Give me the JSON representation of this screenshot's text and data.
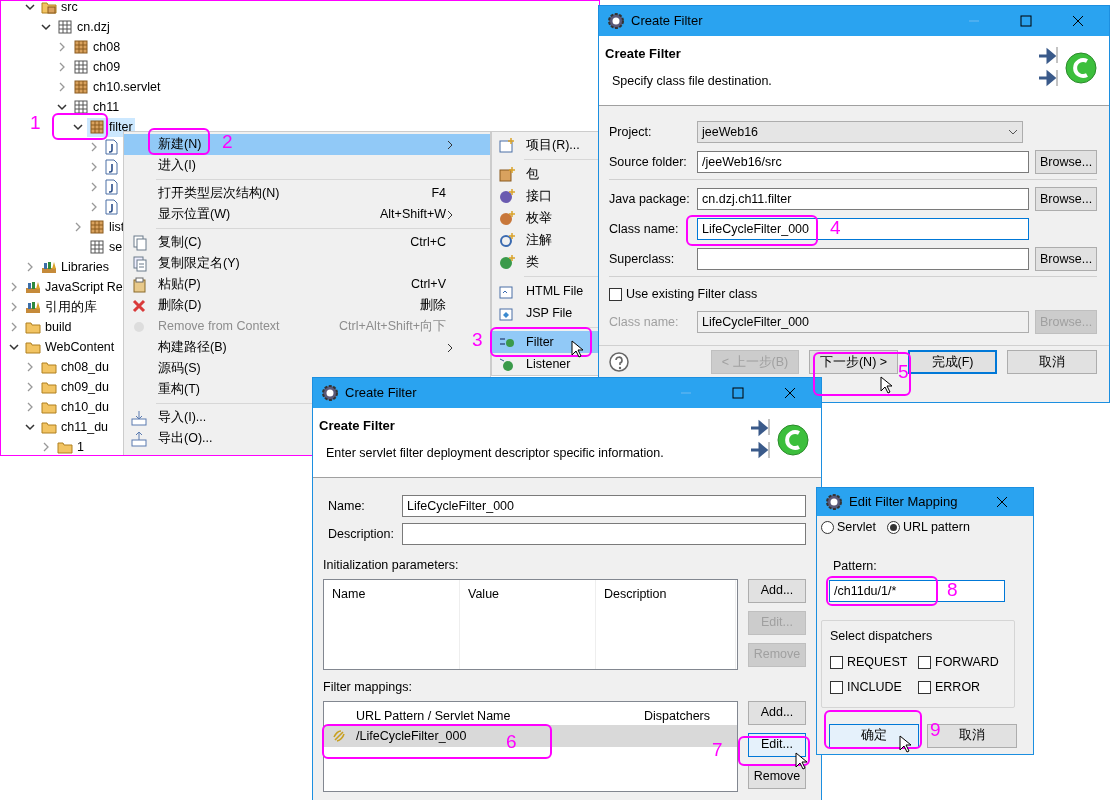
{
  "tree": {
    "project_children": [
      {
        "label": "src",
        "kind": "source-folder",
        "expanded": true,
        "selected": false,
        "children": [
          {
            "label": "cn.dzj",
            "kind": "empty-package",
            "expanded": true,
            "selected": false,
            "children": [
              {
                "label": "ch08",
                "kind": "package",
                "expanded": false,
                "selected": false
              },
              {
                "label": "ch09",
                "kind": "empty-package",
                "expanded": false,
                "selected": false
              },
              {
                "label": "ch10.servlet",
                "kind": "package",
                "expanded": false,
                "selected": false
              },
              {
                "label": "ch11",
                "kind": "empty-package",
                "expanded": true,
                "selected": false,
                "children": [
                  {
                    "label": "filter",
                    "kind": "package",
                    "expanded": true,
                    "selected": true,
                    "children": [
                      {
                        "kind": "java-file",
                        "expanded": false,
                        "selected": false
                      },
                      {
                        "kind": "java-file",
                        "expanded": false,
                        "selected": false
                      },
                      {
                        "kind": "java-file",
                        "expanded": false,
                        "selected": false
                      },
                      {
                        "kind": "java-file",
                        "expanded": false,
                        "selected": false
                      }
                    ]
                  },
                  {
                    "label": "list",
                    "kind": "package",
                    "expanded": false,
                    "selected": false
                  },
                  {
                    "label": "se",
                    "kind": "empty-package",
                    "selected": false
                  }
                ]
              }
            ]
          }
        ]
      },
      {
        "label": "Libraries",
        "kind": "library",
        "expanded": false,
        "selected": false
      }
    ],
    "items": [
      {
        "label": "JavaScript Re",
        "kind": "library",
        "expanded": false,
        "selected": false
      },
      {
        "label": "引用的库",
        "kind": "library",
        "expanded": false,
        "selected": false
      },
      {
        "label": "build",
        "kind": "folder",
        "expanded": false,
        "selected": false
      },
      {
        "label": "WebContent",
        "kind": "folder",
        "expanded": true,
        "selected": false,
        "children": [
          {
            "label": "ch08_du",
            "kind": "folder",
            "expanded": false,
            "selected": false
          },
          {
            "label": "ch09_du",
            "kind": "folder",
            "expanded": false,
            "selected": false
          },
          {
            "label": "ch10_du",
            "kind": "folder",
            "expanded": false,
            "selected": false
          },
          {
            "label": "ch11_du",
            "kind": "folder",
            "expanded": true,
            "selected": false,
            "children": [
              {
                "label": "1",
                "kind": "folder",
                "expanded": false,
                "selected": false
              }
            ]
          }
        ]
      }
    ]
  },
  "context_menu": [
    {
      "kind": "item",
      "label": "新建(N)",
      "submenu": true,
      "selected": true,
      "disabled": false
    },
    {
      "kind": "item",
      "label": "进入(I)",
      "submenu": false,
      "selected": false,
      "disabled": false
    },
    {
      "kind": "separator"
    },
    {
      "kind": "item",
      "label": "打开类型层次结构(N)",
      "shortcut": "F4",
      "submenu": false,
      "selected": false,
      "disabled": false
    },
    {
      "kind": "item",
      "label": "显示位置(W)",
      "shortcut": "Alt+Shift+W",
      "submenu": true,
      "selected": false,
      "disabled": false
    },
    {
      "kind": "separator"
    },
    {
      "kind": "item",
      "label": "复制(C)",
      "shortcut": "Ctrl+C",
      "submenu": false,
      "selected": false,
      "disabled": false
    },
    {
      "kind": "item",
      "label": "复制限定名(Y)",
      "submenu": false,
      "selected": false,
      "disabled": false
    },
    {
      "kind": "item",
      "label": "粘贴(P)",
      "shortcut": "Ctrl+V",
      "submenu": false,
      "selected": false,
      "disabled": false
    },
    {
      "kind": "item",
      "label": "删除(D)",
      "shortcut": "删除",
      "submenu": false,
      "selected": false,
      "disabled": false
    },
    {
      "kind": "item",
      "label": "Remove from Context",
      "shortcut": "Ctrl+Alt+Shift+向下",
      "submenu": false,
      "selected": false,
      "disabled": true
    },
    {
      "kind": "item",
      "label": "构建路径(B)",
      "submenu": true,
      "selected": false,
      "disabled": false
    },
    {
      "kind": "item",
      "label": "源码(S)",
      "submenu": false,
      "selected": false,
      "disabled": false
    },
    {
      "kind": "item",
      "label": "重构(T)",
      "selected": false,
      "disabled": false
    },
    {
      "kind": "separator"
    },
    {
      "kind": "item",
      "label": "导入(I)...",
      "selected": false,
      "disabled": false
    },
    {
      "kind": "item",
      "label": "导出(O)...",
      "selected": false,
      "disabled": false
    }
  ],
  "submenu": [
    {
      "kind": "item",
      "label": "项目(R)...",
      "selected": false
    },
    {
      "kind": "separator"
    },
    {
      "kind": "item",
      "label": "包",
      "selected": false
    },
    {
      "kind": "item",
      "label": "接口",
      "selected": false
    },
    {
      "kind": "item",
      "label": "枚举",
      "selected": false
    },
    {
      "kind": "item",
      "label": "注解",
      "selected": false
    },
    {
      "kind": "item",
      "label": "类",
      "selected": false
    },
    {
      "kind": "separator"
    },
    {
      "kind": "item",
      "label": "HTML File",
      "selected": false
    },
    {
      "kind": "item",
      "label": "JSP File",
      "selected": false
    },
    {
      "kind": "separator"
    },
    {
      "kind": "item",
      "label": "Filter",
      "selected": true
    },
    {
      "kind": "item",
      "label": "Listener",
      "selected": false
    }
  ],
  "class_dialog": {
    "title": "Create Filter",
    "heading": "Create Filter",
    "description": "Specify class file destination.",
    "project": {
      "label": "Project:",
      "value": "jeeWeb16"
    },
    "fields": [
      {
        "kind": "field",
        "label": "Source folder:",
        "value": "/jeeWeb16/src",
        "browse": "Browse...",
        "focused": false
      },
      {
        "kind": "separator"
      },
      {
        "kind": "field",
        "label": "Java package:",
        "value": "cn.dzj.ch11.filter",
        "browse": "Browse...",
        "focused": false
      },
      {
        "kind": "field",
        "label": "Class name:",
        "value": "LifeCycleFilter_000",
        "focused": true
      },
      {
        "kind": "field",
        "label": "Superclass:",
        "browse": "Browse...",
        "focused": false
      },
      {
        "kind": "separator"
      }
    ],
    "use_existing": {
      "label": "Use existing Filter class",
      "checked": false
    },
    "existing_class": {
      "label": "Class name:",
      "value": "LifeCycleFilter_000",
      "browse": "Browse...",
      "disabled": true
    },
    "buttons": [
      {
        "label": "< 上一步(B)",
        "disabled": true,
        "default": false
      },
      {
        "label": "下一步(N) >",
        "disabled": false,
        "default": false
      },
      {
        "label": "完成(F)",
        "disabled": false,
        "default": true
      },
      {
        "label": "取消",
        "disabled": false,
        "default": false
      }
    ]
  },
  "filter_dialog": {
    "title": "Create Filter",
    "heading": "Create Filter",
    "description": "Enter servlet filter deployment descriptor specific information.",
    "fields": [
      {
        "label": "Name:",
        "value": "LifeCycleFilter_000"
      },
      {
        "label": "Description:"
      }
    ],
    "init_params": {
      "label": "Initialization parameters:",
      "columns": [
        "Name",
        "Value",
        "Description"
      ],
      "buttons": [
        {
          "label": "Add...",
          "disabled": false,
          "focused": false
        },
        {
          "label": "Edit...",
          "disabled": true,
          "focused": false
        },
        {
          "label": "Remove",
          "disabled": true,
          "focused": false
        }
      ]
    },
    "mappings": {
      "label": "Filter mappings:",
      "columns": [
        "URL Pattern / Servlet Name",
        "Dispatchers"
      ],
      "rows": [
        {
          "pattern": "/LifeCycleFilter_000",
          "selected": true
        }
      ],
      "buttons": [
        {
          "label": "Add...",
          "disabled": false,
          "focused": false
        },
        {
          "label": "Edit...",
          "disabled": false,
          "focused": true
        },
        {
          "label": "Remove",
          "disabled": false,
          "focused": false
        }
      ]
    }
  },
  "mapping_dialog": {
    "title": "Edit Filter Mapping",
    "types": [
      {
        "label": "Servlet",
        "selected": false
      },
      {
        "label": "URL pattern",
        "selected": true
      }
    ],
    "pattern": {
      "label": "Pattern:",
      "value": "/ch11du/1/*"
    },
    "dispatchers": {
      "label": "Select dispatchers",
      "options": [
        {
          "label": "REQUEST",
          "checked": false
        },
        {
          "label": "FORWARD",
          "checked": false
        },
        {
          "label": "INCLUDE",
          "checked": false
        },
        {
          "label": "ERROR",
          "checked": false
        }
      ]
    },
    "buttons": [
      {
        "label": "确定",
        "default": true
      },
      {
        "label": "取消",
        "default": false
      }
    ]
  },
  "annotations": [
    {
      "number": "1"
    },
    {
      "number": "2"
    },
    {
      "number": "3"
    },
    {
      "number": "4"
    },
    {
      "number": "5"
    },
    {
      "number": "6"
    },
    {
      "number": "7"
    },
    {
      "number": "8"
    },
    {
      "number": "9"
    }
  ]
}
